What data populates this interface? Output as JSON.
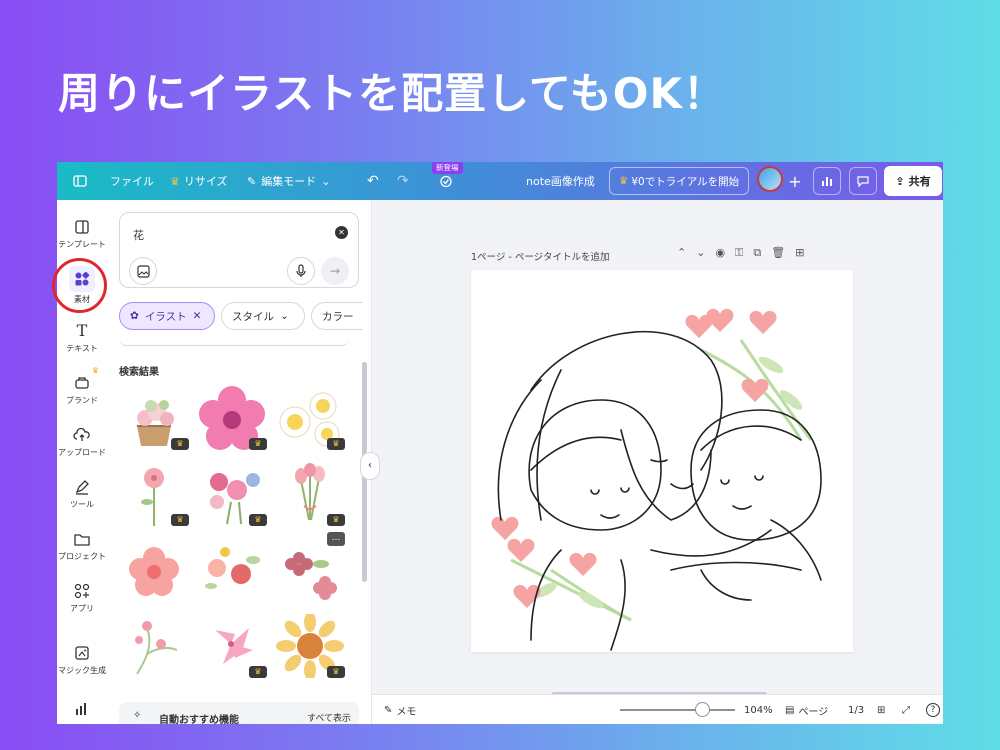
{
  "headline": "周りにイラストを配置してもOK！",
  "topbar": {
    "file": "ファイル",
    "resize": "リサイズ",
    "edit_mode": "編集モード",
    "new_badge": "新登場",
    "doc_title": "note画像作成",
    "trial": "¥0でトライアルを開始",
    "share": "共有"
  },
  "rail": {
    "items": [
      {
        "label": "テンプレート",
        "icon": "template-icon"
      },
      {
        "label": "素材",
        "icon": "elements-icon"
      },
      {
        "label": "テキスト",
        "icon": "text-icon"
      },
      {
        "label": "ブランド",
        "icon": "brand-icon"
      },
      {
        "label": "アップロード",
        "icon": "upload-icon"
      },
      {
        "label": "ツール",
        "icon": "draw-icon"
      },
      {
        "label": "プロジェクト",
        "icon": "folder-icon"
      },
      {
        "label": "アプリ",
        "icon": "apps-icon"
      },
      {
        "label": "マジック生成",
        "icon": "magic-icon"
      }
    ]
  },
  "panel": {
    "search_value": "花",
    "chips": [
      "イラスト",
      "スタイル",
      "カラー"
    ],
    "results_title": "検索結果",
    "bottom_card_label": "自動おすすめ機能",
    "bottom_card_link": "すべて表示"
  },
  "canvas": {
    "page_label": "1ページ - ページタイトルを追加"
  },
  "status": {
    "notes": "メモ",
    "zoom": "104%",
    "pages_label": "ページ",
    "page_count": "1/3",
    "help": "?"
  },
  "colors": {
    "accent": "#8b3ff0",
    "highlight": "#e0252c"
  }
}
